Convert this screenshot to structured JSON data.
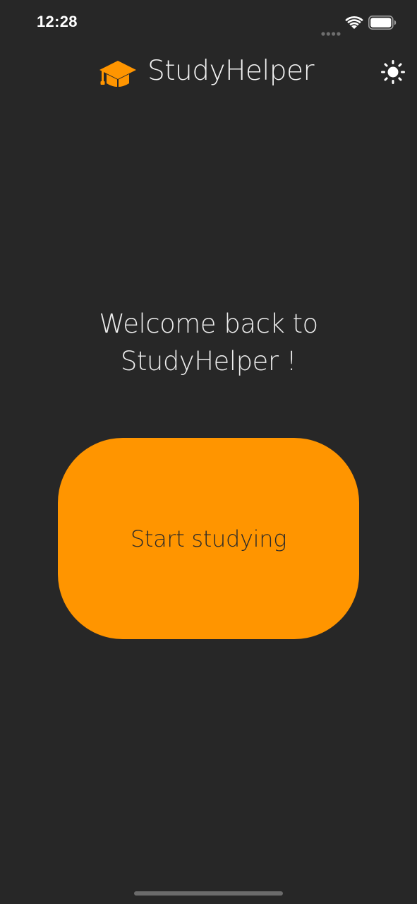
{
  "status_bar": {
    "time": "12:28",
    "icons": [
      "signal-dots-icon",
      "wifi-icon",
      "battery-icon"
    ]
  },
  "header": {
    "app_title": "StudyHelper",
    "logo_icon": "graduation-cap-icon",
    "theme_toggle_icon": "sun-icon"
  },
  "main": {
    "welcome_line_1": "Welcome back to",
    "welcome_line_2": "StudyHelper !",
    "start_button_label": "Start studying"
  },
  "colors": {
    "background": "#272727",
    "accent": "#ff9500",
    "text": "#f2f2f2",
    "button_text": "#2a2a2a"
  }
}
